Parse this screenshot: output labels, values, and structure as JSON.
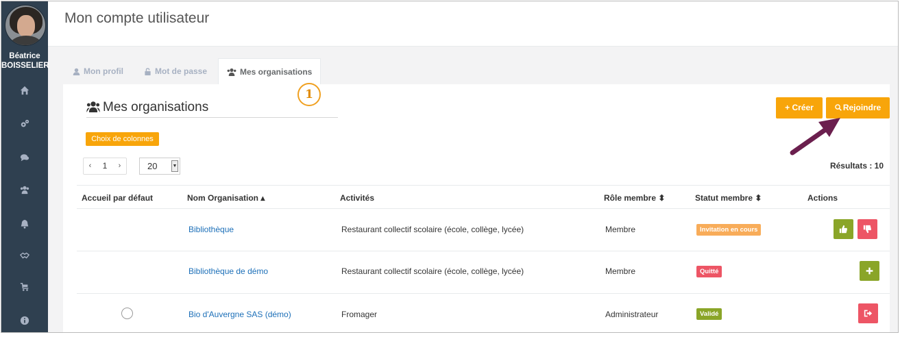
{
  "user": {
    "first_name": "Béatrice",
    "last_name": "BOISSELIER"
  },
  "sidebar": {
    "items": [
      {
        "icon": "home-icon"
      },
      {
        "icon": "cogs-icon"
      },
      {
        "icon": "comments-icon"
      },
      {
        "icon": "users-icon"
      },
      {
        "icon": "bell-icon"
      },
      {
        "icon": "handshake-icon"
      },
      {
        "icon": "cart-icon"
      },
      {
        "icon": "info-icon"
      }
    ]
  },
  "header": {
    "title": "Mon compte utilisateur"
  },
  "tabs": [
    {
      "label": "Mon profil",
      "icon": "user-icon",
      "active": false
    },
    {
      "label": "Mot de passe",
      "icon": "lock-icon",
      "active": false
    },
    {
      "label": "Mes organisations",
      "icon": "users-icon",
      "active": true
    }
  ],
  "callout": "1",
  "section": {
    "title": "Mes organisations",
    "create_label": "+ Créer",
    "join_label": "Rejoindre",
    "columns_label": "Choix de colonnes"
  },
  "pager": {
    "prev": "‹",
    "page": "1",
    "next": "›",
    "page_size": "20"
  },
  "results_label": "Résultats : 10",
  "table": {
    "headers": {
      "default_home": "Accueil par défaut",
      "name": "Nom Organisation ▴",
      "activities": "Activités",
      "role": "Rôle membre ⬍",
      "status": "Statut membre ⬍",
      "actions": "Actions"
    },
    "rows": [
      {
        "name": "Bibliothèque",
        "activities": "Restaurant collectif scolaire (école, collège, lycée)",
        "role": "Membre",
        "status": "Invitation en cours"
      },
      {
        "name": "Bibliothèque de démo",
        "activities": "Restaurant collectif scolaire (école, collège, lycée)",
        "role": "Membre",
        "status": "Quitté"
      },
      {
        "name": "Bio d'Auvergne SAS (démo)",
        "activities": "Fromager",
        "role": "Administrateur",
        "status": "Validé"
      }
    ]
  },
  "colors": {
    "sidebar": "#2f4050",
    "accent": "#f8a50a",
    "link": "#1c6fb8",
    "invitation": "#f8ac59",
    "quit": "#ed5565",
    "validated": "#8aa528",
    "arrow": "#6b1f4e"
  }
}
